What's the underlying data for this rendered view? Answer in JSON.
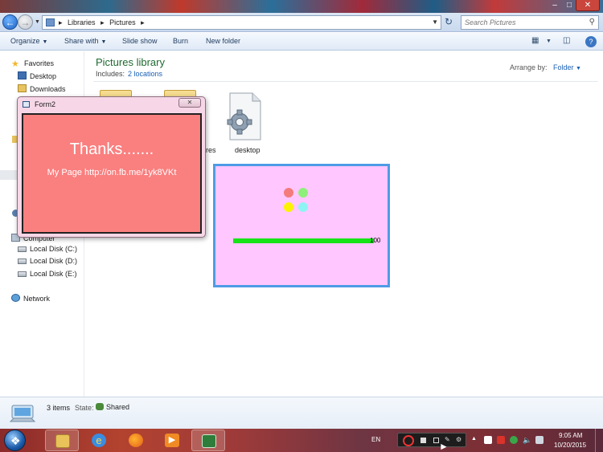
{
  "window": {
    "address": {
      "crumbs": [
        "Libraries",
        "Pictures"
      ]
    },
    "search": {
      "placeholder": "Search Pictures"
    }
  },
  "toolbar": {
    "organize": "Organize",
    "share_with": "Share with",
    "slide_show": "Slide show",
    "burn": "Burn",
    "new_folder": "New folder"
  },
  "sidebar": {
    "favorites": "Favorites",
    "desktop": "Desktop",
    "downloads": "Downloads",
    "computer": "Computer",
    "drives": [
      "Local Disk (C:)",
      "Local Disk (D:)",
      "Local Disk (E:)"
    ],
    "network": "Network"
  },
  "library": {
    "title": "Pictures library",
    "includes_label": "Includes:",
    "includes_link": "2 locations",
    "arrange_label": "Arrange by:",
    "arrange_value": "Folder",
    "partial_label": "res",
    "file_label": "desktop"
  },
  "app_window": {
    "dots": [
      "#f37b7b",
      "#8ef07a",
      "#fbf200",
      "#8ef3f3"
    ],
    "progress_value": 100,
    "progress_label": "100",
    "progress_color": "#17e317",
    "background": "#ffc6ff",
    "border_color": "#4f9be6"
  },
  "form2": {
    "title": "Form2",
    "heading": "Thanks.......",
    "link_text": "My Page http://on.fb.me/1yk8VKt",
    "body_color": "#fa7f7f"
  },
  "details": {
    "items": "3 items",
    "state_label": "State:",
    "state_value": "Shared"
  },
  "taskbar": {
    "language": "EN",
    "time": "9:05 AM",
    "date": "10/20/2015"
  }
}
